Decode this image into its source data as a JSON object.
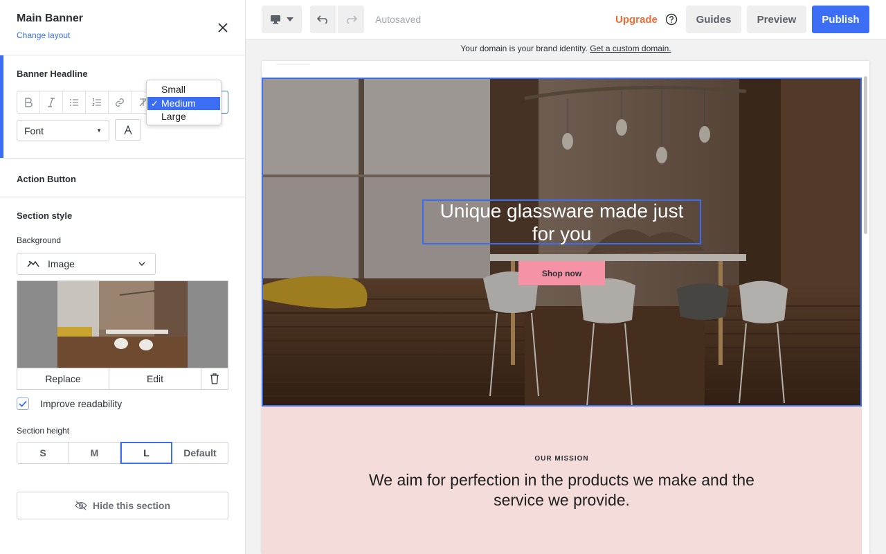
{
  "panel": {
    "title": "Main Banner",
    "subtitle": "Change layout",
    "headline_section": "Banner Headline",
    "font_label": "Font",
    "size_options": [
      "Small",
      "Medium",
      "Large"
    ],
    "size_selected": "Medium",
    "size_check": "✓",
    "action_section": "Action Button",
    "style_section": "Section style",
    "background_label": "Background",
    "background_value": "Image",
    "replace_label": "Replace",
    "edit_label": "Edit",
    "readability_label": "Improve readability",
    "readability_checked": true,
    "height_label": "Section height",
    "height_options": [
      "S",
      "M",
      "L",
      "Default"
    ],
    "height_selected": "L",
    "hide_label": "Hide this section"
  },
  "topbar": {
    "status": "Autosaved",
    "upgrade": "Upgrade",
    "guides": "Guides",
    "preview": "Preview",
    "publish": "Publish"
  },
  "notice": {
    "text": "Your domain is your brand identity.",
    "link": "Get a custom domain."
  },
  "banner": {
    "headline": "Unique glassware made just for you",
    "button": "Shop now"
  },
  "mission": {
    "kicker": "OUR MISSION",
    "text": "We aim for perfection in the products we make and the service we provide."
  },
  "colors": {
    "accent": "#3b6ef5",
    "upgrade": "#ef6b35",
    "shop_button": "#f592a5",
    "mission_bg": "#f3dcd9"
  }
}
